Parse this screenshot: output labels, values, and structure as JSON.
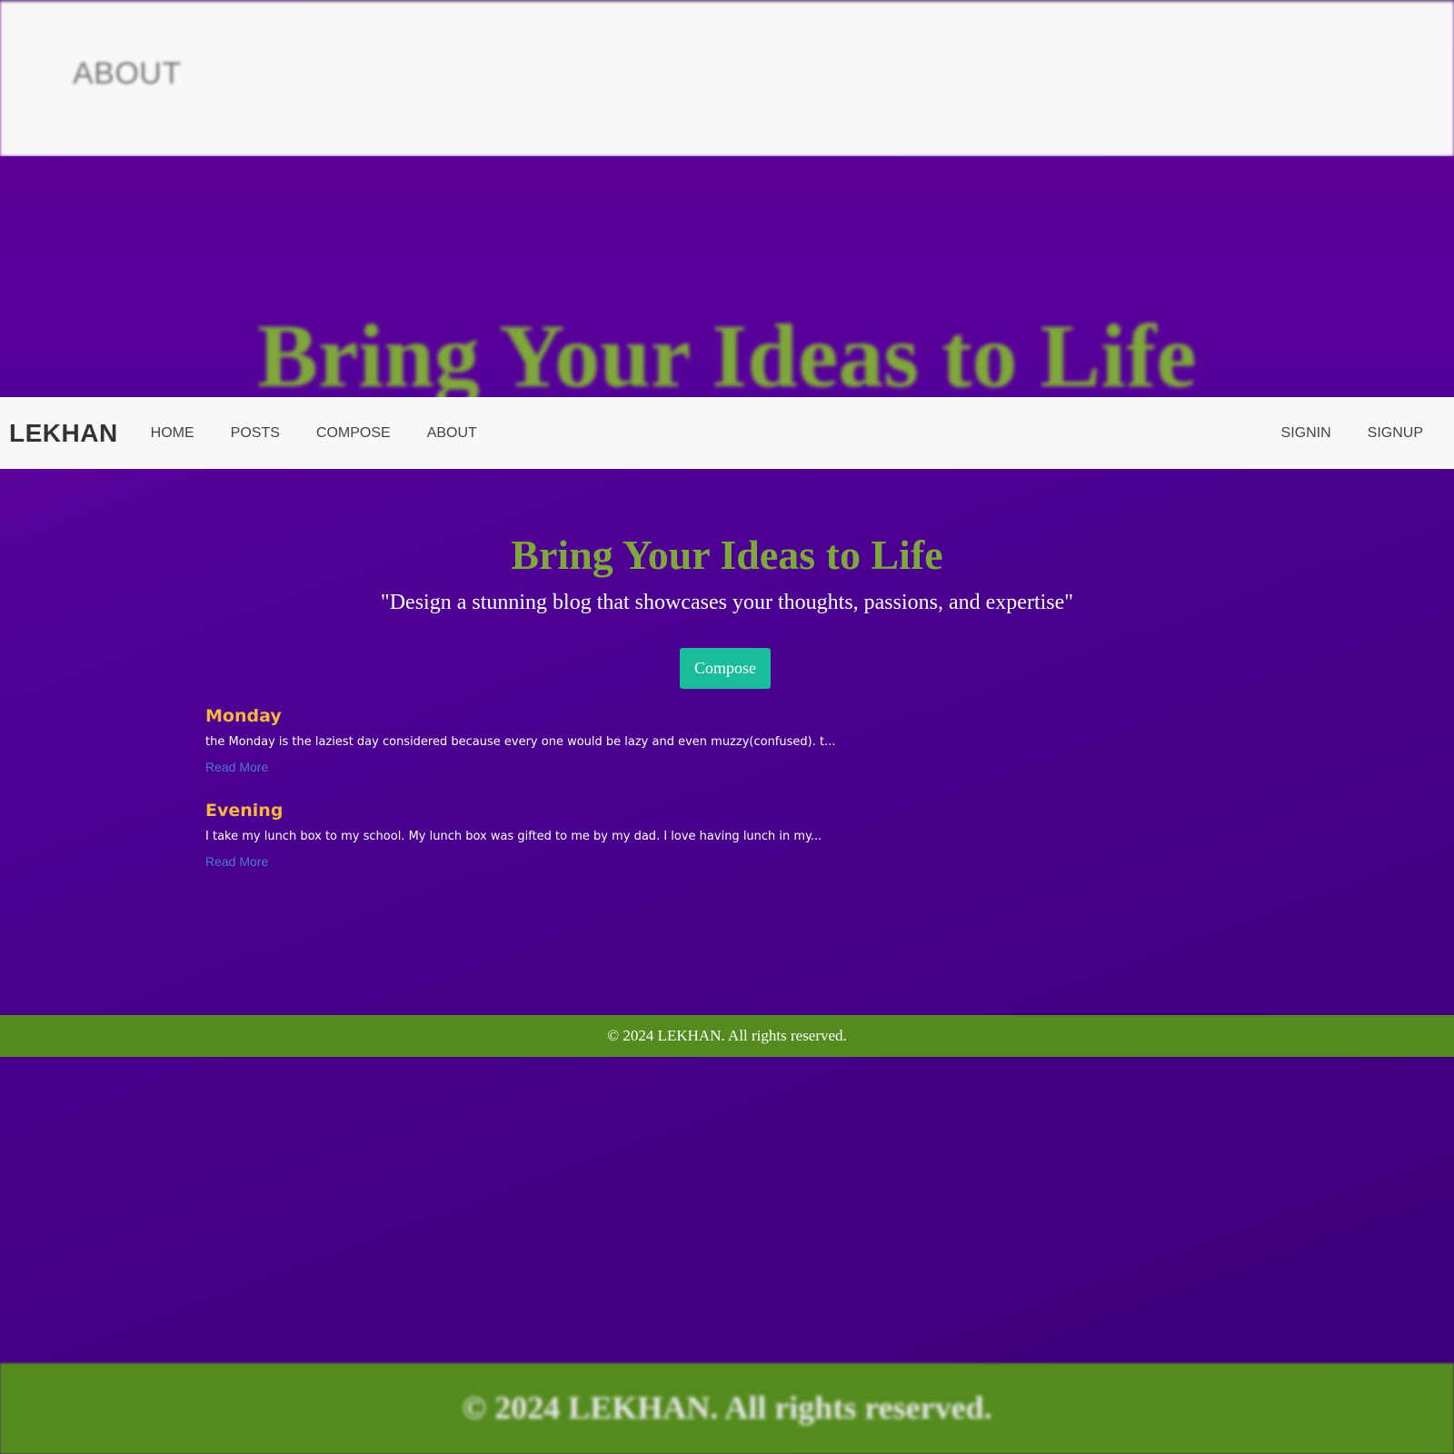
{
  "background": {
    "top_bar_label": "ABOUT",
    "hero_title": "Bring Your Ideas to Life",
    "footer_text": "© 2024 LEKHAN. All rights reserved."
  },
  "nav": {
    "brand": "LEKHAN",
    "links": [
      "HOME",
      "POSTS",
      "COMPOSE",
      "ABOUT"
    ],
    "right_links": [
      "SIGNIN",
      "SIGNUP"
    ]
  },
  "hero": {
    "title": "Bring Your Ideas to Life",
    "subtitle": "\"Design a stunning blog that showcases your thoughts, passions, and expertise\"",
    "compose_label": "Compose"
  },
  "posts": [
    {
      "title": "Monday",
      "excerpt": "the Monday is the laziest day considered because every one would be lazy and even muzzy(confused). t...",
      "link": "Read More"
    },
    {
      "title": "Evening",
      "excerpt": "I take my lunch box to my school. My lunch box was gifted to me by my dad. I love having lunch in my...",
      "link": "Read More"
    }
  ],
  "footer": {
    "text": "© 2024 LEKHAN. All rights reserved."
  },
  "colors": {
    "accent_green": "#7fa83a",
    "button_teal": "#1abc9c",
    "post_title": "#f4b73c",
    "footer_green": "#548b1e",
    "background_purple": "#4a0090"
  }
}
